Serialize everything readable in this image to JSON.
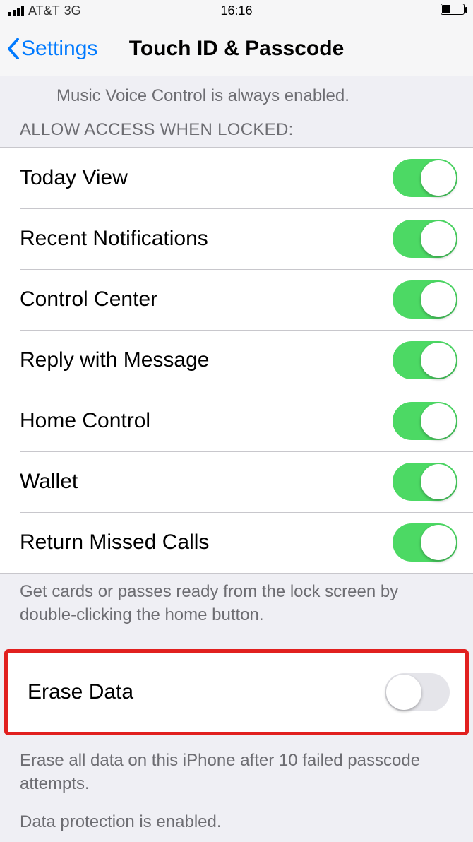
{
  "status_bar": {
    "carrier": "AT&T",
    "network": "3G",
    "time": "16:16"
  },
  "nav": {
    "back_label": "Settings",
    "title": "Touch ID & Passcode"
  },
  "top_footer": "Music Voice Control is always enabled.",
  "allow_section": {
    "header": "ALLOW ACCESS WHEN LOCKED:",
    "items": [
      {
        "label": "Today View",
        "on": true
      },
      {
        "label": "Recent Notifications",
        "on": true
      },
      {
        "label": "Control Center",
        "on": true
      },
      {
        "label": "Reply with Message",
        "on": true
      },
      {
        "label": "Home Control",
        "on": true
      },
      {
        "label": "Wallet",
        "on": true
      },
      {
        "label": "Return Missed Calls",
        "on": true
      }
    ],
    "footer": "Get cards or passes ready from the lock screen by double-clicking the home button."
  },
  "erase_section": {
    "label": "Erase Data",
    "on": false,
    "footer_line1": "Erase all data on this iPhone after 10 failed passcode attempts.",
    "footer_line2": "Data protection is enabled."
  }
}
